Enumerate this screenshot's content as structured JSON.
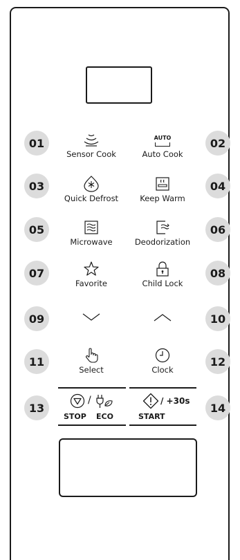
{
  "badges": [
    "01",
    "02",
    "03",
    "04",
    "05",
    "06",
    "07",
    "08",
    "09",
    "10",
    "11",
    "12",
    "13",
    "14"
  ],
  "buttons": {
    "sensor_cook": "Sensor Cook",
    "auto_cook": "Auto Cook",
    "auto_icon_text": "AUTO",
    "quick_defrost": "Quick Defrost",
    "keep_warm": "Keep Warm",
    "microwave": "Microwave",
    "deodorization": "Deodorization",
    "favorite": "Favorite",
    "child_lock": "Child Lock",
    "select": "Select",
    "clock": "Clock"
  },
  "bottom": {
    "stop": "STOP",
    "eco": "ECO",
    "slash": "/",
    "start": "START",
    "plus30": "/ +30s"
  },
  "icons": {
    "sensor_cook": "sensor-waves-icon",
    "auto_cook": "auto-text-icon",
    "quick_defrost": "snowflake-drop-icon",
    "keep_warm": "pot-warm-icon",
    "microwave": "wave-box-icon",
    "deodorization": "door-air-icon",
    "favorite": "star-icon",
    "child_lock": "padlock-icon",
    "down": "chevron-down-icon",
    "up": "chevron-up-icon",
    "select": "hand-pointer-icon",
    "clock": "clock-icon",
    "stop": "stop-triangle-icon",
    "eco": "plug-leaf-icon",
    "start": "start-diamond-icon"
  }
}
